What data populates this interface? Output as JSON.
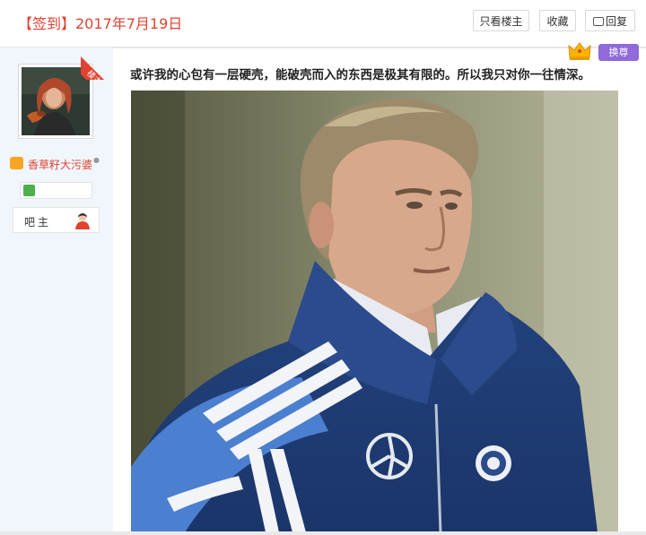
{
  "header": {
    "title": "【签到】2017年7月19日",
    "buttons": {
      "only_op": "只看楼主",
      "favorite": "收藏",
      "reply": "回复"
    }
  },
  "author": {
    "op_tag": "楼主",
    "name": "香草籽大污婆",
    "rank_label": "吧主"
  },
  "post": {
    "swap_label": "换尊",
    "text": "或许我的心包有一层硬壳，能破壳而入的东西是极其有限的。所以我只对你一往情深。"
  },
  "colors": {
    "accent_red": "#e0432f",
    "sidebar_bg": "#f1f6fc",
    "swap_purple": "#8f6ad8"
  }
}
